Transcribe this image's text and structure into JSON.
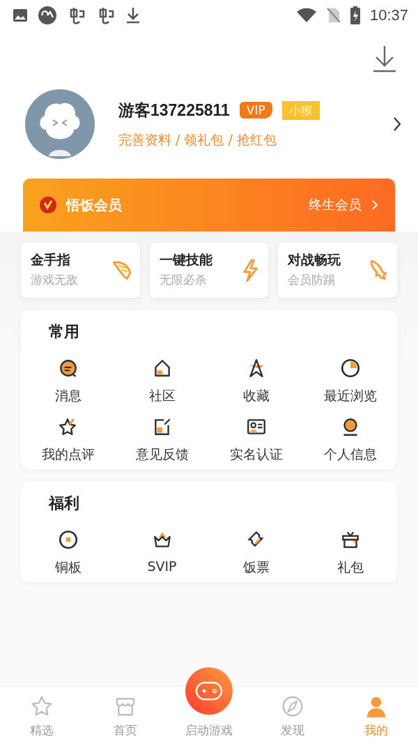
{
  "status_bar": {
    "time": "10:37"
  },
  "profile": {
    "name": "游客137225811",
    "badges": [
      {
        "kind": "vip",
        "label": "VIP"
      },
      {
        "kind": "level",
        "label": "小猴"
      }
    ],
    "links": "完善资料 / 领礼包 / 抢红包"
  },
  "membership": {
    "title": "悟饭会员",
    "action": "终生会员"
  },
  "features": [
    {
      "title": "金手指",
      "subtitle": "游戏无敌"
    },
    {
      "title": "一键技能",
      "subtitle": "无限必杀"
    },
    {
      "title": "对战畅玩",
      "subtitle": "会员防踢"
    }
  ],
  "sections": [
    {
      "title": "常用",
      "items": [
        "消息",
        "社区",
        "收藏",
        "最近浏览",
        "我的点评",
        "意见反馈",
        "实名认证",
        "个人信息"
      ]
    },
    {
      "title": "福利",
      "items": [
        "铜板",
        "SVIP",
        "饭票",
        "礼包"
      ]
    }
  ],
  "tab_bar": [
    {
      "kind": "tab",
      "label": "精选",
      "selected": false
    },
    {
      "kind": "tab",
      "label": "首页",
      "selected": false
    },
    {
      "kind": "launch",
      "label": "启动游戏",
      "selected": false
    },
    {
      "kind": "tab",
      "label": "发现",
      "selected": false
    },
    {
      "kind": "tab",
      "label": "我的",
      "selected": true
    }
  ]
}
